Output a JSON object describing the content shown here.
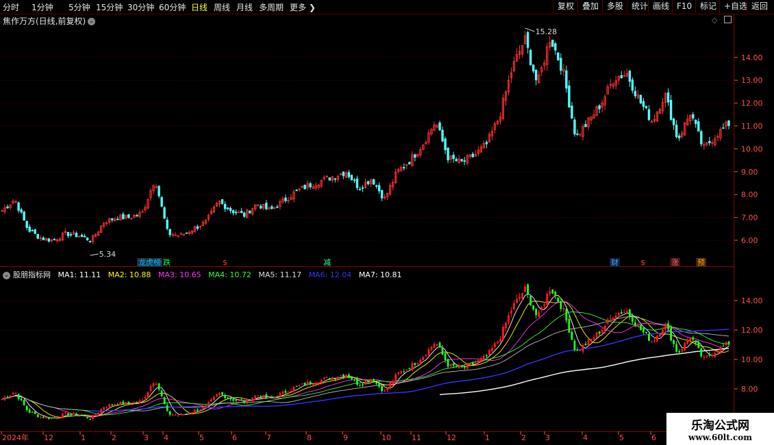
{
  "toolbar": {
    "timeframes": [
      "分时",
      "1分钟",
      "5分钟",
      "15分钟",
      "30分钟",
      "60分钟",
      "日线",
      "周线",
      "月线",
      "多周期",
      "更多"
    ],
    "active": "日线",
    "right_buttons": [
      "复权",
      "叠加",
      "多股",
      "统计",
      "画线",
      "F10",
      "标记",
      "+自选",
      "返回"
    ]
  },
  "main_chart": {
    "title": "焦作万方(日线,前复权)",
    "high_label": "15.28",
    "low_label": "5.34",
    "y_ticks": [
      "14.00",
      "13.00",
      "12.00",
      "11.00",
      "10.00",
      "9.00",
      "8.00",
      "7.00",
      "6.00"
    ],
    "events": [
      {
        "text": "龙虎榜",
        "color": "#00bfff"
      },
      {
        "text": "跌",
        "color": "#00ff66"
      },
      {
        "text": "$",
        "color": "#ff3333"
      },
      {
        "text": "减",
        "color": "#33ff99"
      },
      {
        "text": "财",
        "color": "#4da6ff"
      },
      {
        "text": "$",
        "color": "#ff3333"
      },
      {
        "text": "涨",
        "color": "#ff6666"
      },
      {
        "text": "预",
        "color": "#ffaa00"
      }
    ]
  },
  "indicator": {
    "name": "股朋指标网",
    "ma": [
      {
        "label": "MA1: 11.11",
        "color": "#ffffff"
      },
      {
        "label": "MA2: 10.88",
        "color": "#ffff00"
      },
      {
        "label": "MA3: 10.65",
        "color": "#ff33ff"
      },
      {
        "label": "MA4: 10.72",
        "color": "#33ff33"
      },
      {
        "label": "MA5: 11.17",
        "color": "#dddddd"
      },
      {
        "label": "MA6: 12.04",
        "color": "#3333ff"
      },
      {
        "label": "MA7: 10.81",
        "color": "#ffffff"
      }
    ],
    "y_ticks": [
      "14.00",
      "12.00",
      "10.00",
      "8.00"
    ]
  },
  "x_axis": [
    "2024年",
    "12",
    "1",
    "2",
    "3",
    "4",
    "5",
    "6",
    "7",
    "8",
    "9",
    "10",
    "11",
    "12",
    "1",
    "2",
    "3",
    "4",
    "5",
    "6"
  ],
  "watermark": {
    "line1": "乐淘公式网",
    "line2": "www.60lt.com"
  },
  "chart_data": {
    "type": "candlestick",
    "title": "焦作万方(日线,前复权)",
    "anchor_closes": [
      7.3,
      7.8,
      6.5,
      6.1,
      6.0,
      6.3,
      6.2,
      6.0,
      6.8,
      7.0,
      7.0,
      7.2,
      8.7,
      6.3,
      6.2,
      6.5,
      6.8,
      7.7,
      7.3,
      7.1,
      7.6,
      7.3,
      7.7,
      8.1,
      8.4,
      8.6,
      8.8,
      9.0,
      8.3,
      8.7,
      7.8,
      9.0,
      9.5,
      10.2,
      11.2,
      9.6,
      9.4,
      9.7,
      10.2,
      11.4,
      13.5,
      14.8,
      12.8,
      14.9,
      13.4,
      10.5,
      11.2,
      12.0,
      13.1,
      13.3,
      12.1,
      11.2,
      12.4,
      10.4,
      11.6,
      10.0,
      10.6,
      11.1
    ],
    "high": 15.28,
    "low": 5.34,
    "ylim": [
      5.3,
      15.5
    ],
    "ma_values": {
      "MA1": 11.11,
      "MA2": 10.88,
      "MA3": 10.65,
      "MA4": 10.72,
      "MA5": 11.17,
      "MA6": 12.04,
      "MA7": 10.81
    }
  }
}
